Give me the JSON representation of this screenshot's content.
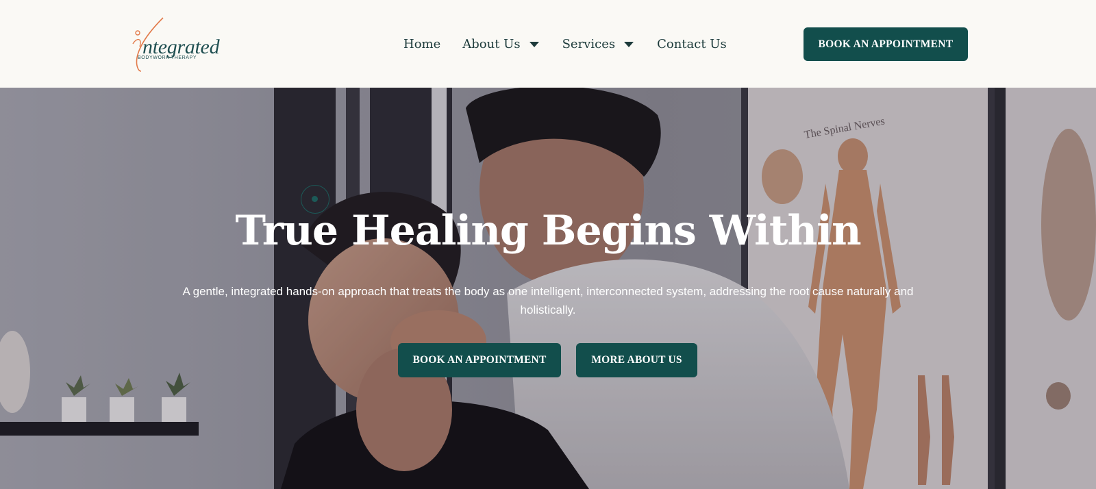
{
  "brand": {
    "logo_word": "ntegrated",
    "logo_sub": "BODYWORK THERAPY"
  },
  "nav": {
    "items": [
      {
        "label": "Home",
        "has_dropdown": false
      },
      {
        "label": "About Us",
        "has_dropdown": true
      },
      {
        "label": "Services",
        "has_dropdown": true
      },
      {
        "label": "Contact Us",
        "has_dropdown": false
      }
    ]
  },
  "header": {
    "cta_label": "BOOK AN APPOINTMENT"
  },
  "hero": {
    "title": "True Healing Begins Within",
    "subtitle": "A gentle, integrated hands-on approach that treats the body as one intelligent, interconnected system, addressing the root cause naturally and holistically.",
    "primary_cta": "BOOK AN APPOINTMENT",
    "secondary_cta": "MORE ABOUT US",
    "poster_heading": "The Spinal Nerves"
  },
  "colors": {
    "accent": "#124e4c",
    "header_bg": "#faf9f5",
    "nav_text": "#1d3b3b",
    "logo_orange": "#e27a4a"
  }
}
